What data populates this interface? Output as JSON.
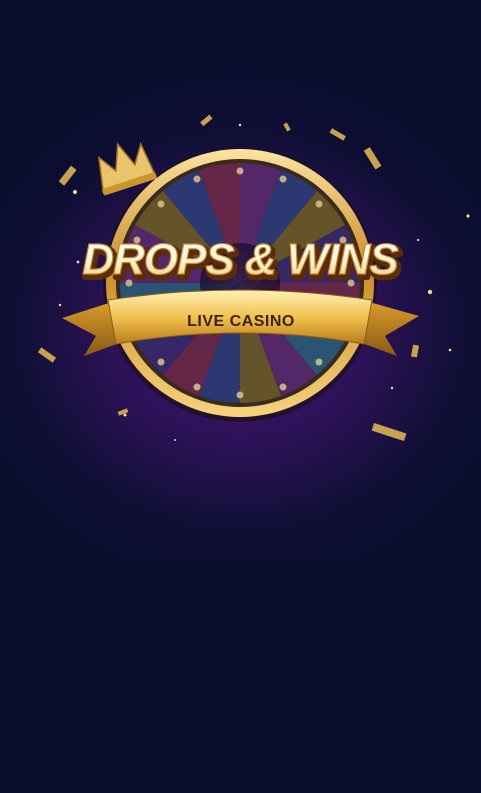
{
  "logo": {
    "title": "DROPS & WINS",
    "subtitle": "LIVE CASINO",
    "icon": "crown-icon"
  },
  "colors": {
    "background": "#0a0e2e",
    "gold": "#e8b84a",
    "purple_glow": "#9628c8",
    "ribbon_text": "#3a2405"
  }
}
